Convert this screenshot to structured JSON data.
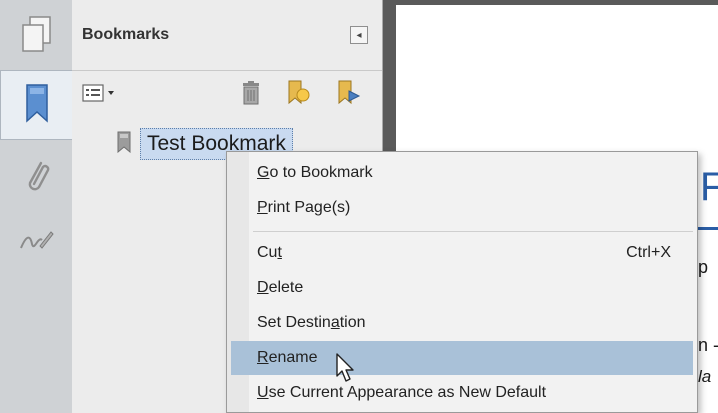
{
  "panel": {
    "title": "Bookmarks",
    "collapse_glyph": "◂"
  },
  "rail": {
    "tabs": [
      {
        "name": "page-thumbnails",
        "icon": "pages-icon"
      },
      {
        "name": "bookmarks",
        "icon": "bookmark-icon",
        "active": true
      },
      {
        "name": "attachments",
        "icon": "paperclip-icon"
      },
      {
        "name": "signatures",
        "icon": "signature-icon"
      }
    ]
  },
  "toolbar": {
    "options_icon": "options-menu-icon",
    "delete_icon": "trash-icon",
    "new_bookmark_icon": "new-bookmark-icon",
    "expand_icon": "bookmark-arrow-icon"
  },
  "tree": {
    "items": [
      {
        "label": "Test Bookmark",
        "selected": true
      }
    ]
  },
  "document": {
    "fragments": [
      "F",
      "p",
      "n -",
      "la"
    ]
  },
  "context_menu": {
    "items": [
      {
        "pre": "",
        "key": "G",
        "post": "o to Bookmark"
      },
      {
        "pre": "",
        "key": "P",
        "post": "rint Page(s)"
      },
      {
        "pre": "Cu",
        "key": "t",
        "post": "",
        "shortcut": "Ctrl+X"
      },
      {
        "pre": "",
        "key": "D",
        "post": "elete"
      },
      {
        "pre": "Set Destin",
        "key": "a",
        "post": "tion"
      },
      {
        "pre": "",
        "key": "R",
        "post": "ename",
        "hover": true
      },
      {
        "pre": "",
        "key": "U",
        "post": "se Current Appearance as New Default"
      }
    ]
  },
  "colors": {
    "selection": "#c9daf0",
    "menu_hover": "#a9c1d8",
    "doc_accent": "#2a5da6"
  }
}
